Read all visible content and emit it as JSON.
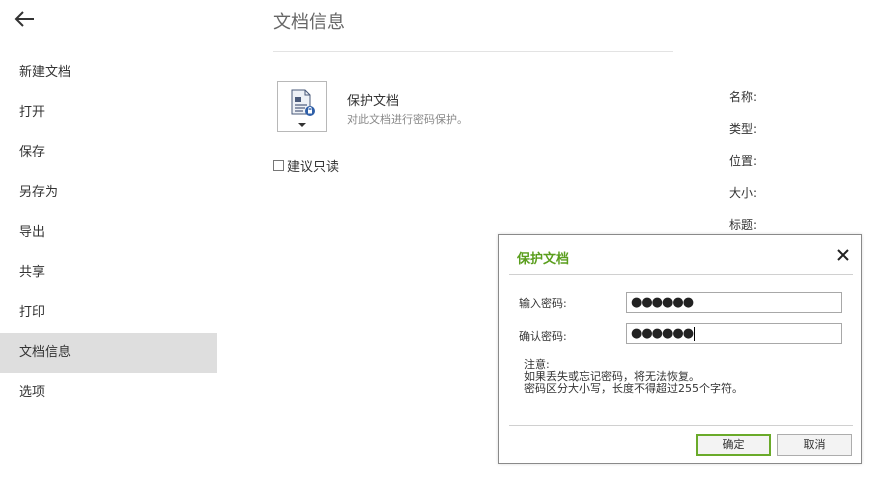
{
  "sidebar": {
    "items": [
      {
        "label": "新建文档",
        "active": false
      },
      {
        "label": "打开",
        "active": false
      },
      {
        "label": "保存",
        "active": false
      },
      {
        "label": "另存为",
        "active": false
      },
      {
        "label": "导出",
        "active": false
      },
      {
        "label": "共享",
        "active": false
      },
      {
        "label": "打印",
        "active": false
      },
      {
        "label": "文档信息",
        "active": true
      },
      {
        "label": "选项",
        "active": false
      }
    ]
  },
  "main": {
    "title": "文档信息",
    "protect": {
      "title": "保护文档",
      "description": "对此文档进行密码保护。"
    },
    "readonly_label": "建议只读",
    "properties": [
      "名称:",
      "类型:",
      "位置:",
      "大小:",
      "标题:"
    ]
  },
  "dialog": {
    "title": "保护文档",
    "password_label": "输入密码:",
    "password_value": "●●●●●●",
    "confirm_label": "确认密码:",
    "confirm_value": "●●●●●●",
    "note_heading": "注意:",
    "note_line1": "如果丢失或忘记密码，将无法恢复。",
    "note_line2": "密码区分大小写，长度不得超过255个字符。",
    "ok_label": "确定",
    "cancel_label": "取消"
  },
  "colors": {
    "accent_green": "#5a9e1d",
    "sidebar_active": "#dedede"
  }
}
